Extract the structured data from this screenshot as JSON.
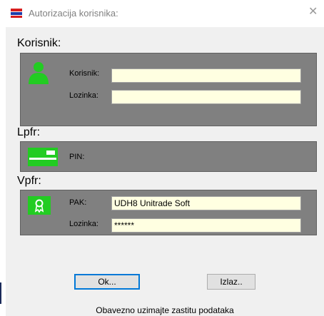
{
  "window": {
    "title": "Autorizacija korisnika:"
  },
  "sections": {
    "korisnik": {
      "heading": "Korisnik:",
      "icon": "user-icon",
      "user_label": "Korisnik:",
      "user_value": "",
      "password_label": "Lozinka:",
      "password_value": ""
    },
    "lpfr": {
      "heading": "Lpfr:",
      "icon": "card-icon",
      "pin_label": "PIN:"
    },
    "vpfr": {
      "heading": "Vpfr:",
      "icon": "certificate-icon",
      "pak_label": "PAK:",
      "pak_value": "UDH8 Unitrade Soft",
      "password_label": "Lozinka:",
      "password_value": "******"
    }
  },
  "buttons": {
    "ok": "Ok...",
    "exit": "Izlaz.."
  },
  "footer": "Obavezno uzimajte zastitu podataka",
  "colors": {
    "panel": "#808080",
    "input_bg": "#ffffe1",
    "icon_green": "#22cc22",
    "accent": "#0078d7"
  }
}
